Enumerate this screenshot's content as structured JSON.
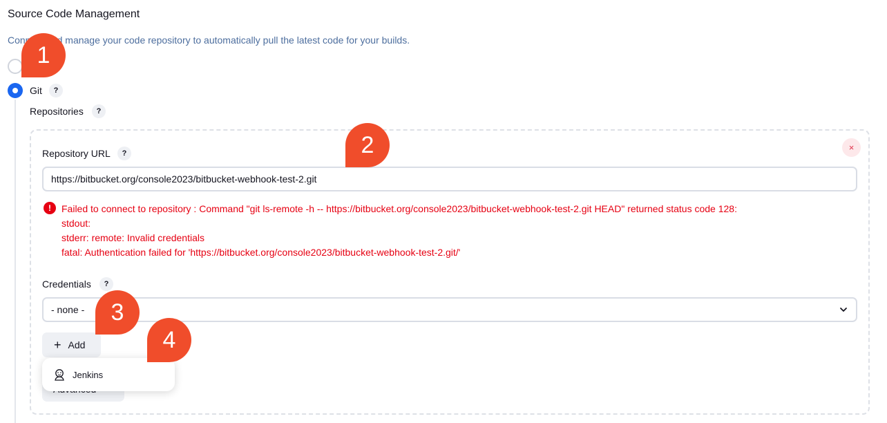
{
  "section": {
    "title": "Source Code Management",
    "description": "Connect and manage your code repository to automatically pull the latest code for your builds."
  },
  "scm": {
    "selected_option_label": "Git",
    "help_mark": "?"
  },
  "repositories": {
    "label": "Repositories",
    "delete_icon": "×",
    "url_label": "Repository URL",
    "url_value": "https://bitbucket.org/console2023/bitbucket-webhook-test-2.git",
    "error_icon": "!",
    "error_lines": [
      "Failed to connect to repository : Command \"git ls-remote -h -- https://bitbucket.org/console2023/bitbucket-webhook-test-2.git HEAD\" returned status code 128:",
      "stdout:",
      "stderr: remote: Invalid credentials",
      "fatal: Authentication failed for 'https://bitbucket.org/console2023/bitbucket-webhook-test-2.git/'"
    ],
    "credentials_label": "Credentials",
    "credentials_value": "- none -",
    "add_label": "Add",
    "plus_icon": "+",
    "advanced_label": "Advanced"
  },
  "add_menu": {
    "items": [
      {
        "label": "Jenkins",
        "icon": "jenkins-icon"
      }
    ]
  },
  "callouts": [
    "1",
    "2",
    "3",
    "4"
  ],
  "colors": {
    "accent": "#1a66f0",
    "error": "#e60012",
    "callout": "#f04d2b",
    "description": "#4d6e9e"
  }
}
